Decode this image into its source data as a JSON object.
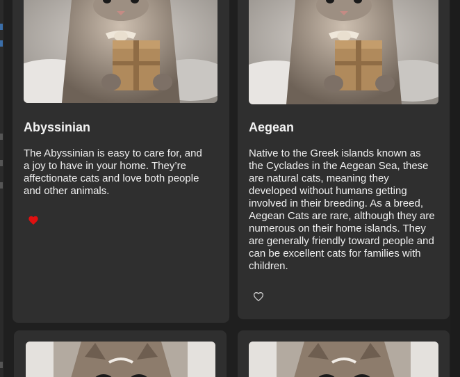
{
  "cards": [
    {
      "title": "Abyssinian",
      "description": "The Abyssinian is easy to care for, and a joy to have in your home. They’re affectionate cats and love both people and other animals.",
      "favorite_icon": "heart-filled-icon",
      "favorited": true
    },
    {
      "title": "Aegean",
      "description": "Native to the Greek islands known as the Cyclades in the Aegean Sea, these are natural cats, meaning they developed without humans getting involved in their breeding. As a breed, Aegean Cats are rare, although they are numerous on their home islands. They are generally friendly toward people and can be excellent cats for families with children.",
      "favorite_icon": "heart-outline-icon",
      "favorited": false
    }
  ],
  "colors": {
    "background": "#1f1f1f",
    "card": "#2f2f2f",
    "favorite_active": "#e01010",
    "favorite_inactive": "#cfcfcf"
  }
}
